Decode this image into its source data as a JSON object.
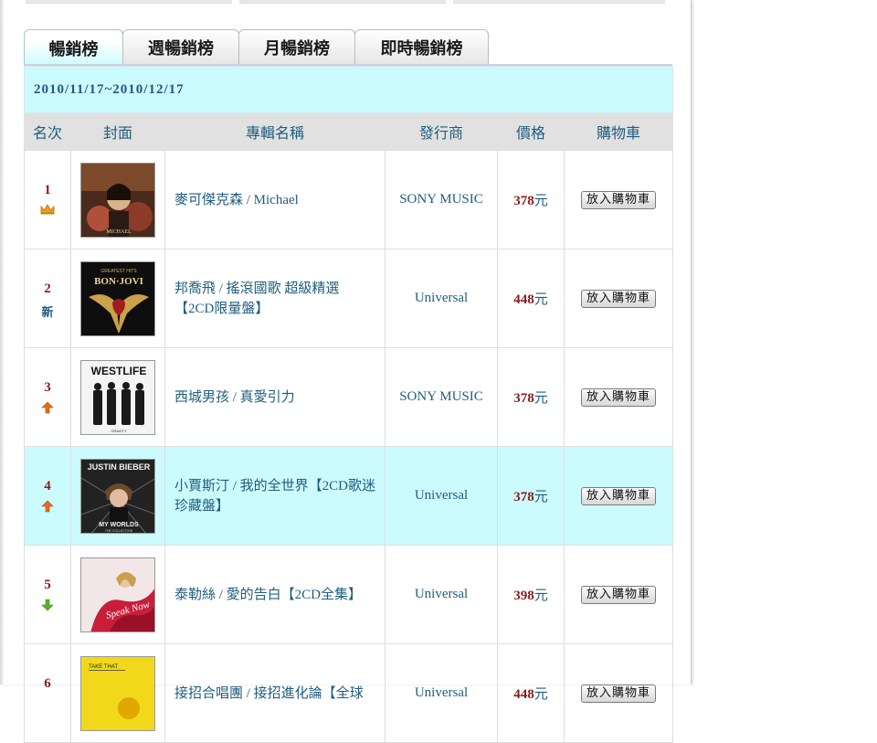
{
  "tabs": [
    {
      "label": "暢銷榜",
      "active": true
    },
    {
      "label": "週暢銷榜",
      "active": false
    },
    {
      "label": "月暢銷榜",
      "active": false
    },
    {
      "label": "即時暢銷榜",
      "active": false
    }
  ],
  "date_range": "2010/11/17~2010/12/17",
  "columns": [
    "名次",
    "封面",
    "專輯名稱",
    "發行商",
    "價格",
    "購物車"
  ],
  "cart_button_label": "放入購物車",
  "currency_unit": "元",
  "rank_new_label": "新",
  "colors": {
    "highlight": "#ccfbfe",
    "header": "#e1e1e1",
    "link": "#1f5d7e",
    "price": "#8b1a1a"
  },
  "rows": [
    {
      "rank": "1",
      "trend": "crown",
      "cover_icon": "album-cover-michael-icon",
      "title": "麥可傑克森 / Michael",
      "publisher": "SONY MUSIC",
      "price": "378",
      "highlight": false
    },
    {
      "rank": "2",
      "trend": "new",
      "cover_icon": "album-cover-bon-jovi-icon",
      "title": "邦喬飛 / 搖滾國歌 超級精選【2CD限量盤】",
      "publisher": "Universal",
      "price": "448",
      "highlight": false
    },
    {
      "rank": "3",
      "trend": "up",
      "cover_icon": "album-cover-westlife-icon",
      "title": "西城男孩 / 真愛引力",
      "publisher": "SONY MUSIC",
      "price": "378",
      "highlight": false
    },
    {
      "rank": "4",
      "trend": "up",
      "cover_icon": "album-cover-justin-bieber-icon",
      "title": "小賈斯汀 / 我的全世界【2CD歌迷珍藏盤】",
      "publisher": "Universal",
      "price": "378",
      "highlight": true
    },
    {
      "rank": "5",
      "trend": "down",
      "cover_icon": "album-cover-taylor-swift-icon",
      "title": "泰勒絲 / 愛的告白【2CD全集】",
      "publisher": "Universal",
      "price": "398",
      "highlight": false
    },
    {
      "rank": "6",
      "trend": "none",
      "cover_icon": "album-cover-take-that-icon",
      "title": "接招合唱團 / 接招進化論【全球",
      "publisher": "Universal",
      "price": "448",
      "highlight": false
    }
  ],
  "covers": {
    "michael": {
      "text": "MICHAEL"
    },
    "bonjovi": {
      "top": "GREATEST HITS",
      "name": "BON·JOVI"
    },
    "westlife": {
      "name": "WESTLIFE",
      "sub": "GRAVITY"
    },
    "bieber": {
      "name": "JUSTIN BIEBER",
      "sub": "MY WORLDS",
      "sub2": "THE COLLECTION"
    },
    "swift": {
      "text": "Speak Now"
    },
    "takethat": {
      "text": "TAKE THAT"
    }
  }
}
